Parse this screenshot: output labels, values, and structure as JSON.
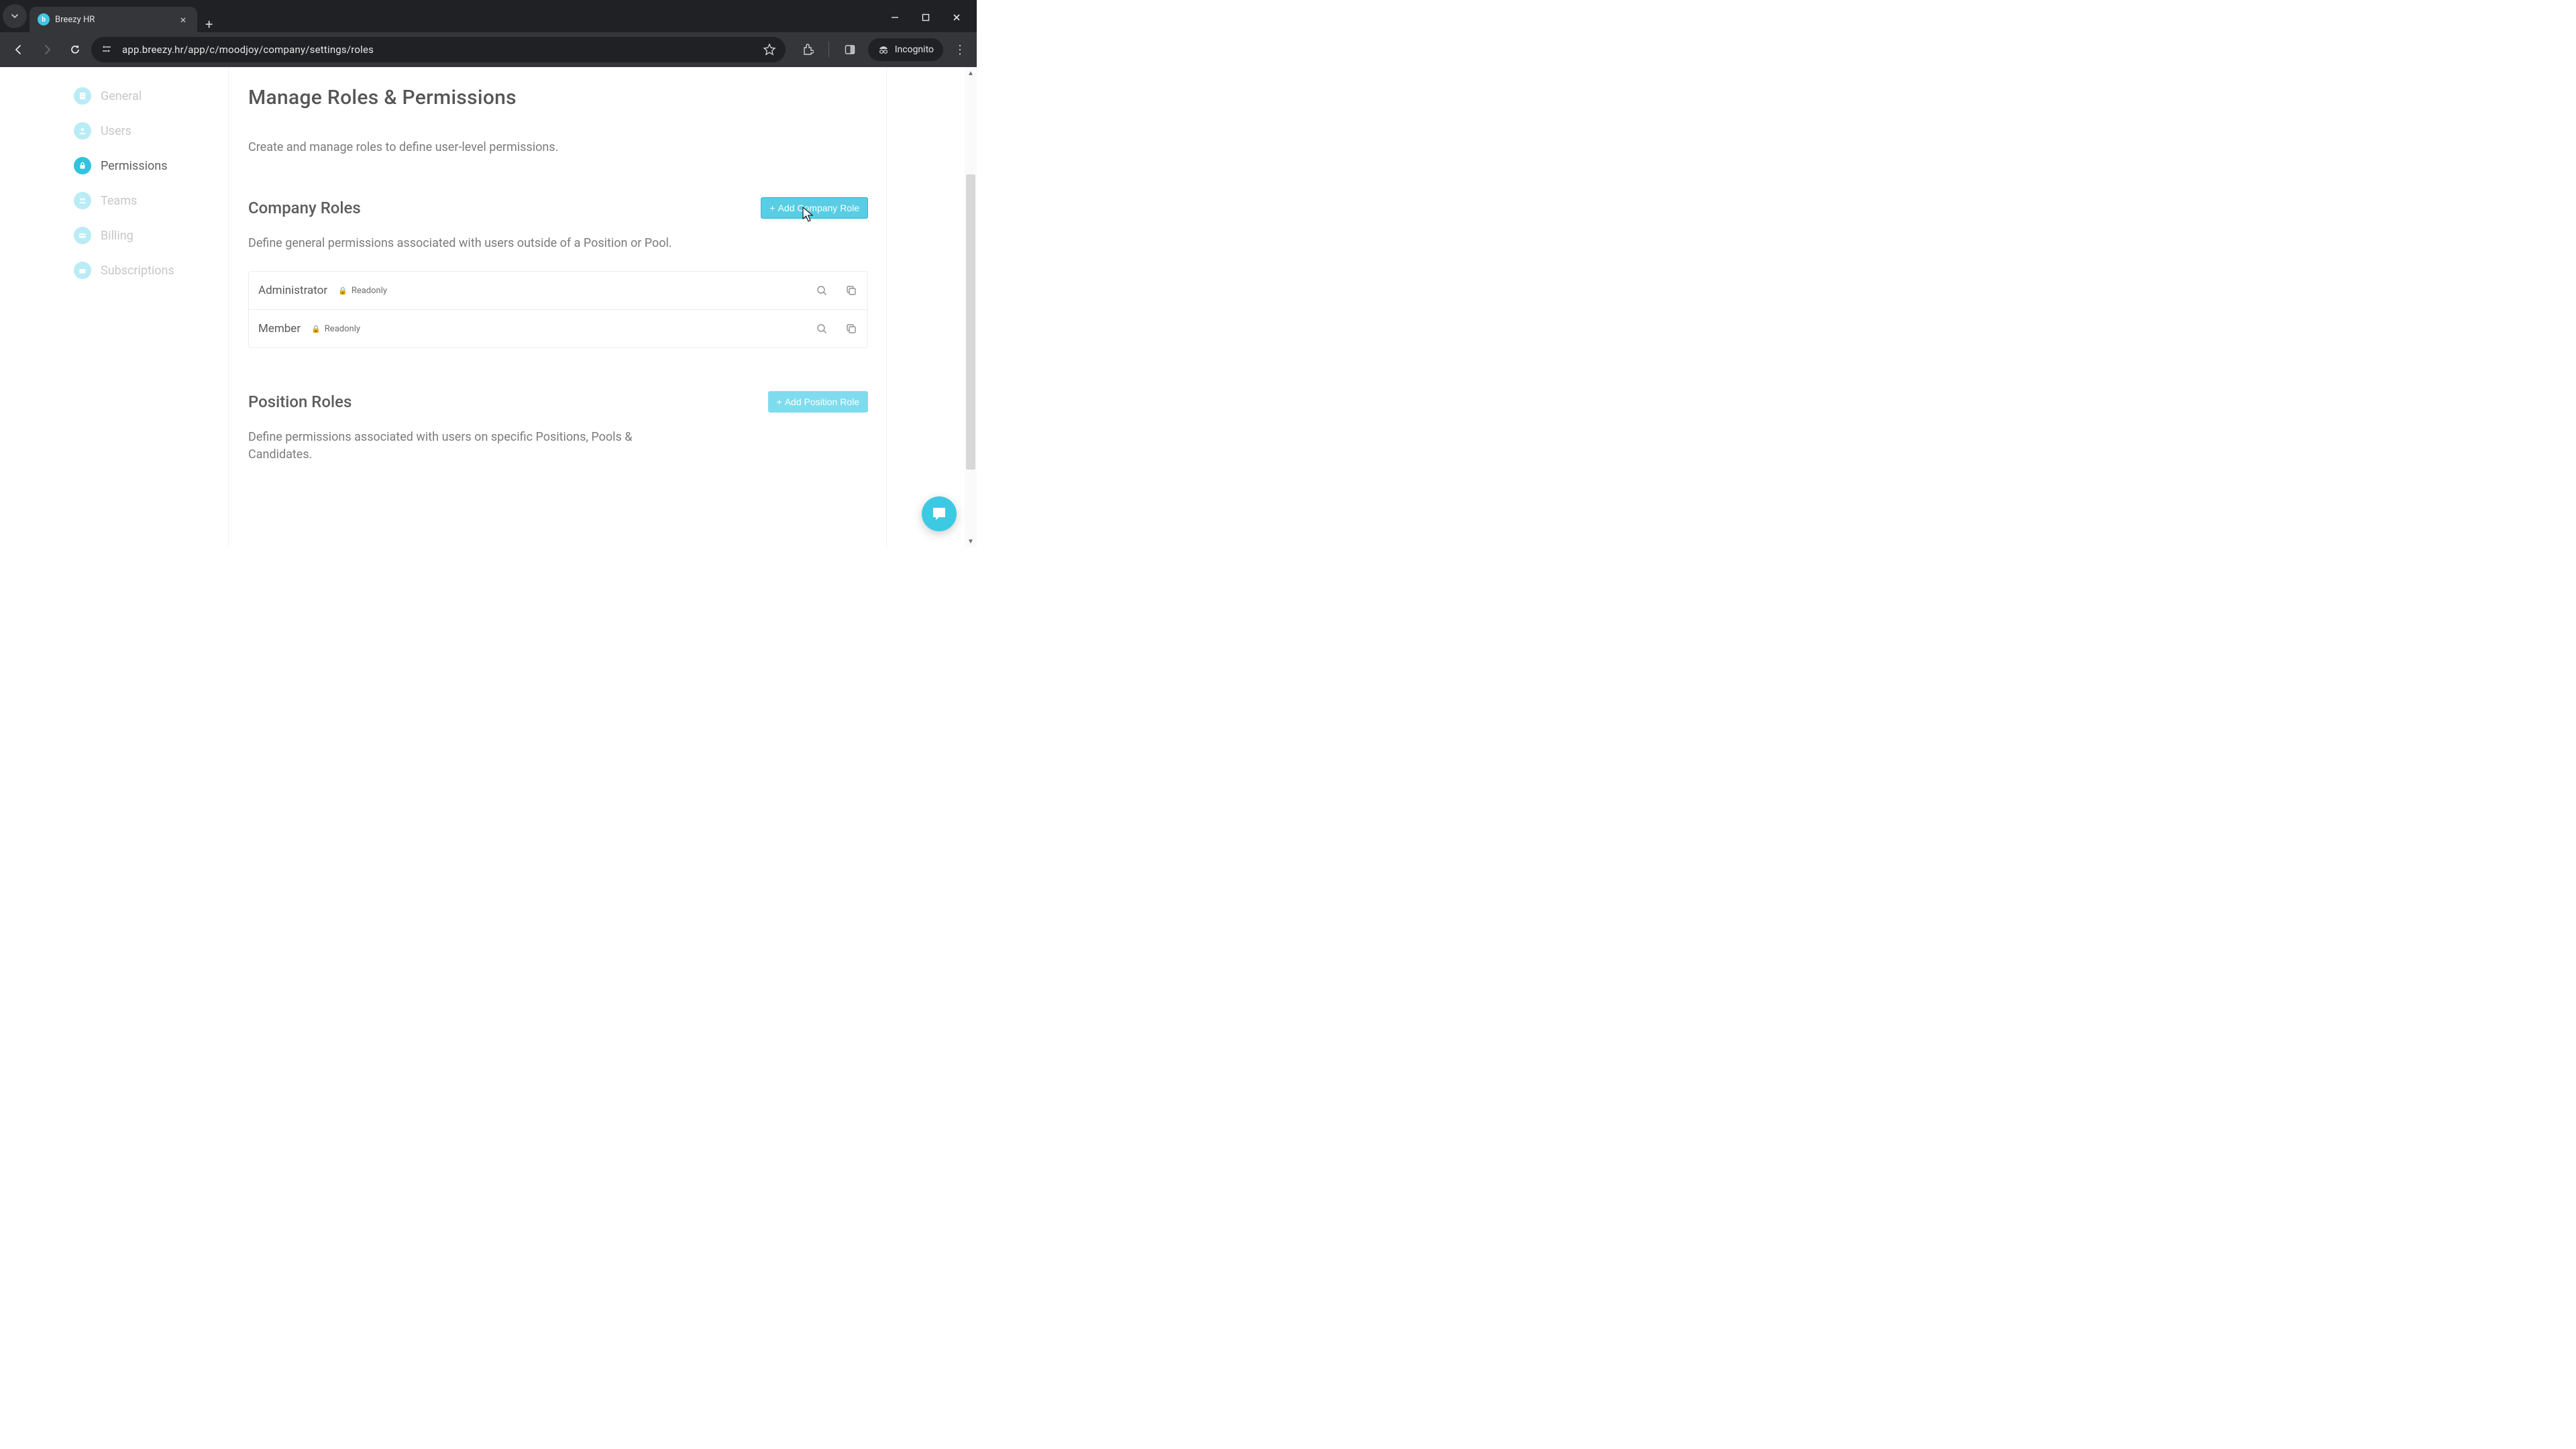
{
  "browser": {
    "tab_title": "Breezy HR",
    "url": "app.breezy.hr/app/c/moodjoy/company/settings/roles",
    "incognito_label": "Incognito"
  },
  "sidebar": {
    "items": [
      {
        "label": "General"
      },
      {
        "label": "Users"
      },
      {
        "label": "Permissions"
      },
      {
        "label": "Teams"
      },
      {
        "label": "Billing"
      },
      {
        "label": "Subscriptions"
      }
    ]
  },
  "page": {
    "title": "Manage Roles & Permissions",
    "subtitle": "Create and manage roles to define user-level permissions."
  },
  "sections": {
    "company": {
      "title": "Company Roles",
      "add_label": "Add Company Role",
      "desc": "Define general permissions associated with users outside of a Position or Pool.",
      "roles": [
        {
          "name": "Administrator",
          "badge": "Readonly"
        },
        {
          "name": "Member",
          "badge": "Readonly"
        }
      ]
    },
    "position": {
      "title": "Position Roles",
      "add_label": "Add Position Role",
      "desc": "Define permissions associated with users on specific Positions, Pools & Candidates."
    }
  },
  "colors": {
    "accent": "#31c3de"
  }
}
